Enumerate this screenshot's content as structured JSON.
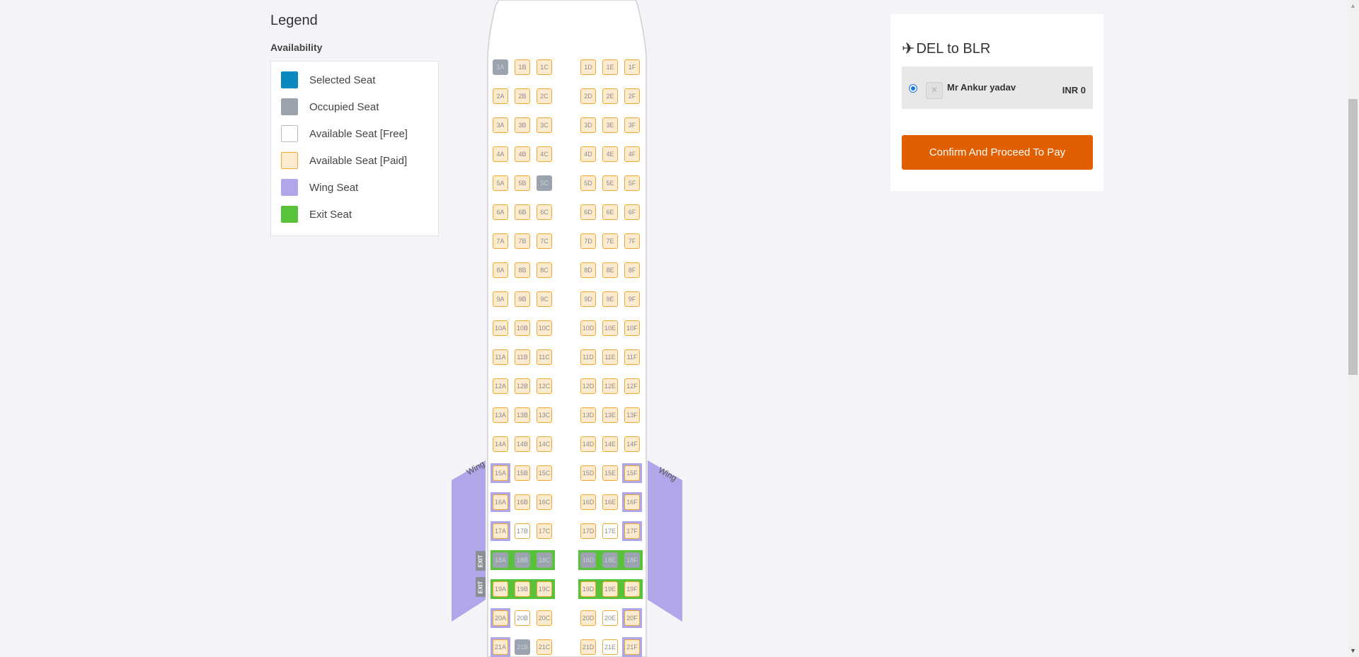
{
  "legend": {
    "title": "Legend",
    "subtitle": "Availability",
    "items": [
      {
        "label": "Selected Seat",
        "color": "#0a89c0"
      },
      {
        "label": "Occupied Seat",
        "color": "#9aa3ae"
      },
      {
        "label": "Available Seat [Free]",
        "color": "#ffffff"
      },
      {
        "label": "Available Seat [Paid]",
        "color": "#fdebd0"
      },
      {
        "label": "Wing Seat",
        "color": "#b0a6ea"
      },
      {
        "label": "Exit Seat",
        "color": "#58c23a"
      }
    ]
  },
  "plane": {
    "wing_label": "Wing",
    "exit_label": "EXIT",
    "rows": [
      "1",
      "2",
      "3",
      "4",
      "5",
      "6",
      "7",
      "8",
      "9",
      "10",
      "11",
      "12",
      "13",
      "14",
      "15",
      "16",
      "17",
      "18",
      "19",
      "20",
      "21"
    ],
    "letters_left": [
      "A",
      "B",
      "C"
    ],
    "letters_right": [
      "D",
      "E",
      "F"
    ],
    "occupied": [
      "1A",
      "5C",
      "18A",
      "18B",
      "18C",
      "18D",
      "18E",
      "18F",
      "21B"
    ],
    "free": [
      "17B",
      "17E",
      "20B",
      "20E",
      "21E"
    ],
    "wing_rows": [
      "15",
      "16",
      "17",
      "20",
      "21"
    ],
    "exit_rows": [
      "18",
      "19"
    ],
    "colors": {
      "paid": "#fdebd0",
      "paid_border": "#f0a830",
      "occupied": "#9aa3ae",
      "wing": "#b0a6ea",
      "exit": "#58c23a"
    }
  },
  "booking": {
    "plane_icon": "airplane-icon",
    "route": "DEL to BLR",
    "passenger": {
      "name": "Mr Ankur yadav",
      "price": "INR 0",
      "seat_icon": "close-icon"
    },
    "confirm_label": "Confirm And Proceed To Pay",
    "accent": "#e15f00"
  }
}
